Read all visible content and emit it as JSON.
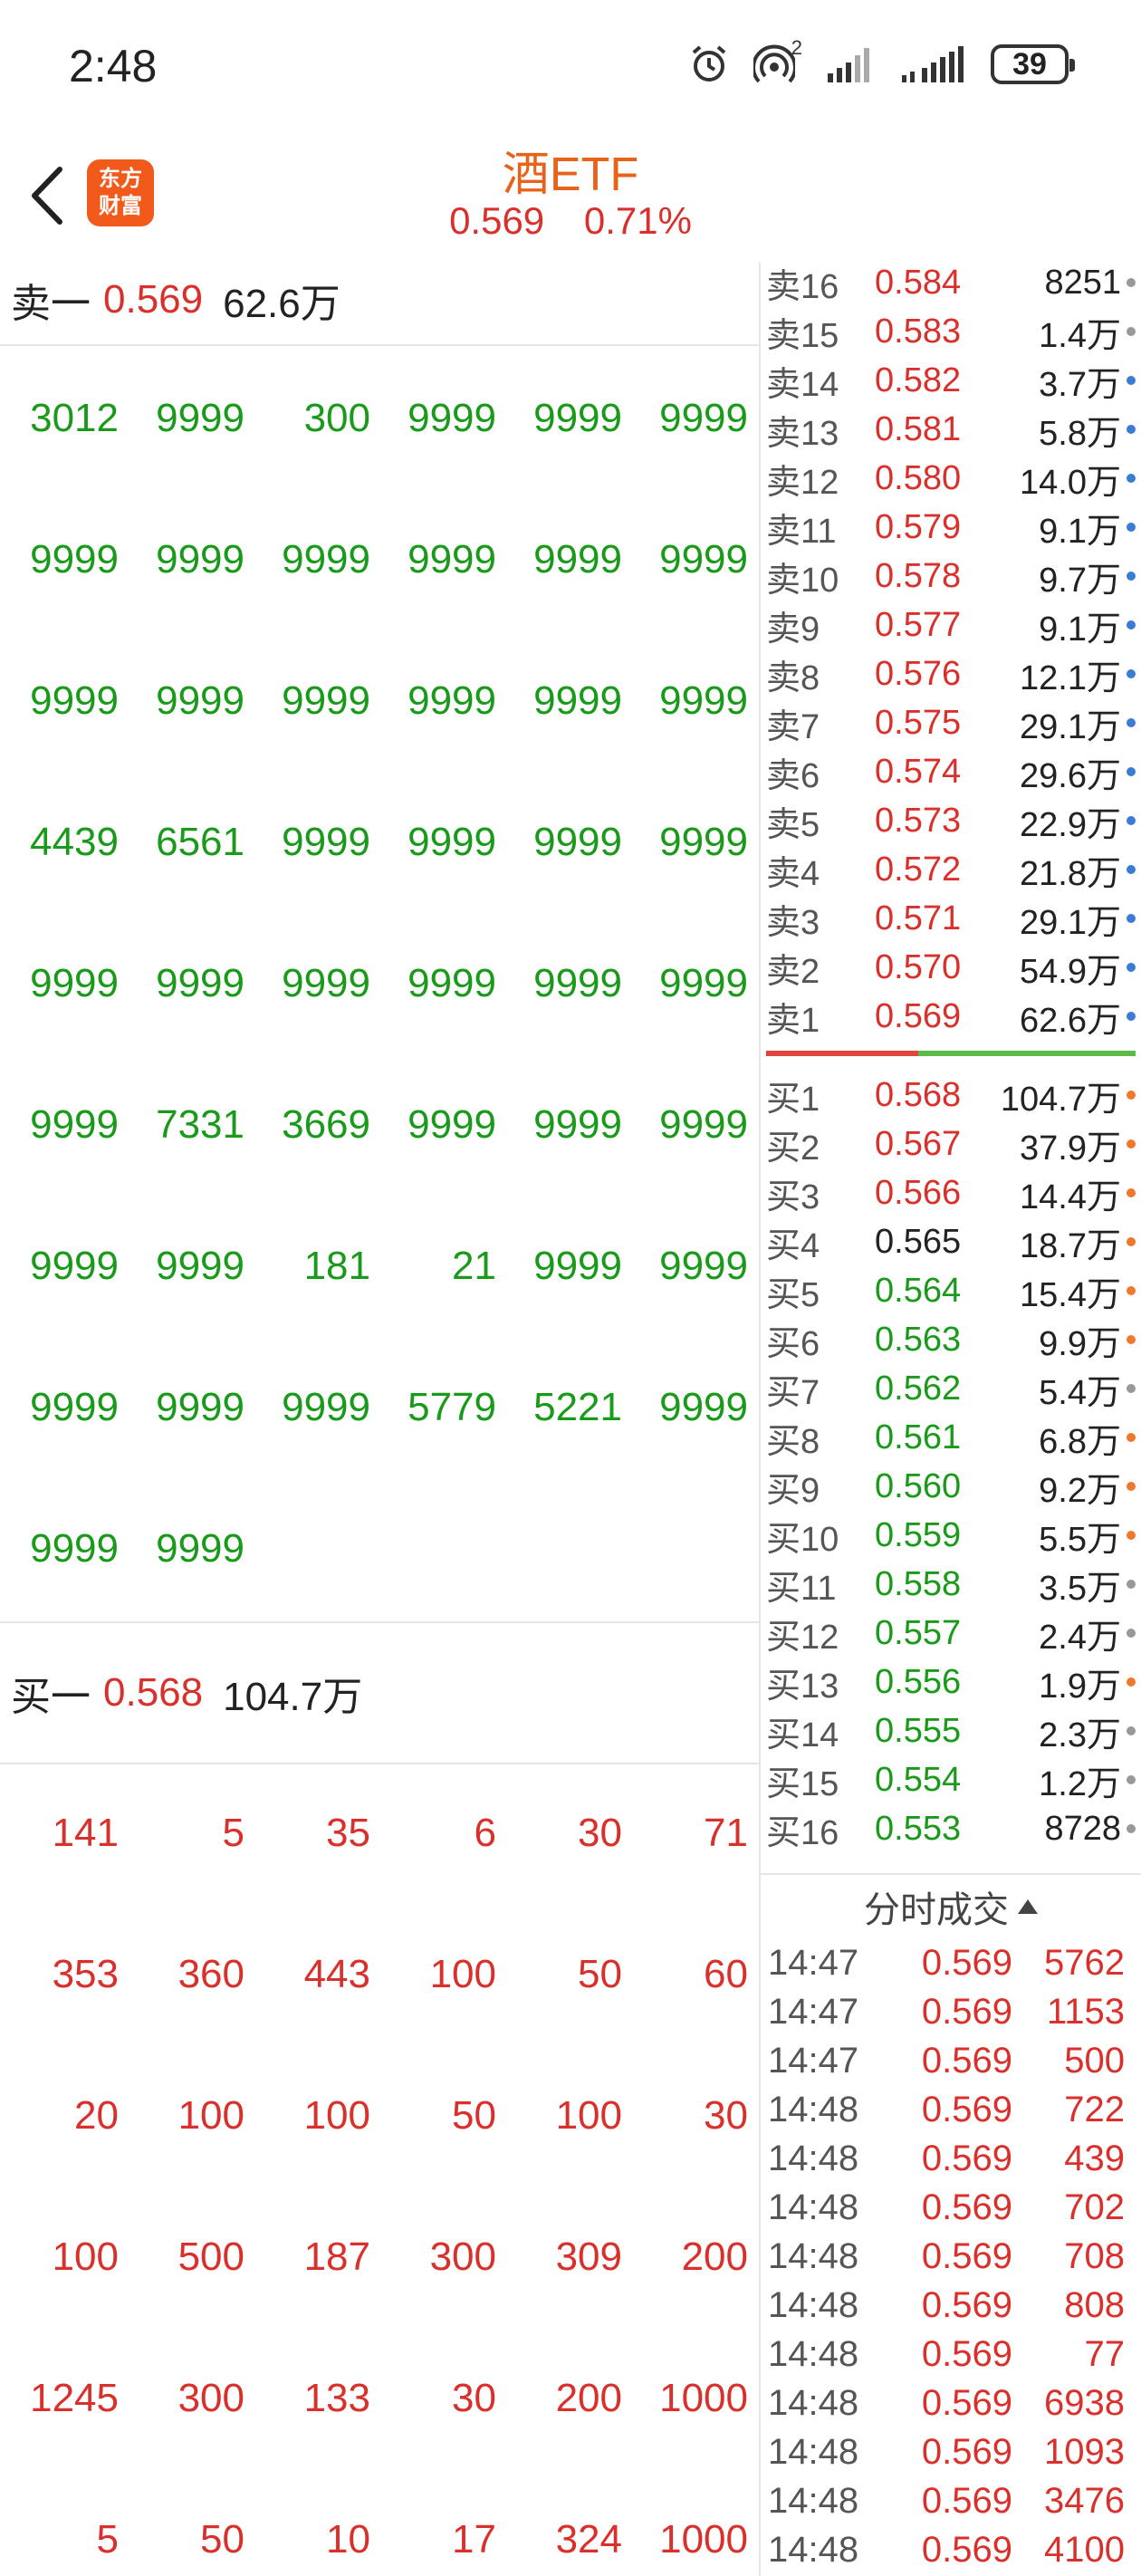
{
  "status": {
    "time": "2:48",
    "battery": "39",
    "hotspot_sup": "2"
  },
  "header": {
    "title": "酒ETF",
    "price": "0.569",
    "change": "0.71%",
    "logo_line1": "东方",
    "logo_line2": "财富"
  },
  "sell_level": {
    "label": "卖一",
    "price": "0.569",
    "volume": "62.6万"
  },
  "buy_level": {
    "label": "买一",
    "price": "0.568",
    "volume": "104.7万"
  },
  "sell_queue": [
    [
      "3012",
      "9999",
      "300",
      "9999",
      "9999",
      "9999"
    ],
    [
      "9999",
      "9999",
      "9999",
      "9999",
      "9999",
      "9999"
    ],
    [
      "9999",
      "9999",
      "9999",
      "9999",
      "9999",
      "9999"
    ],
    [
      "4439",
      "6561",
      "9999",
      "9999",
      "9999",
      "9999"
    ],
    [
      "9999",
      "9999",
      "9999",
      "9999",
      "9999",
      "9999"
    ],
    [
      "9999",
      "7331",
      "3669",
      "9999",
      "9999",
      "9999"
    ],
    [
      "9999",
      "9999",
      "181",
      "21",
      "9999",
      "9999"
    ],
    [
      "9999",
      "9999",
      "9999",
      "5779",
      "5221",
      "9999"
    ],
    [
      "9999",
      "9999",
      "",
      "",
      "",
      ""
    ]
  ],
  "buy_queue": [
    [
      "141",
      "5",
      "35",
      "6",
      "30",
      "71"
    ],
    [
      "353",
      "360",
      "443",
      "100",
      "50",
      "60"
    ],
    [
      "20",
      "100",
      "100",
      "50",
      "100",
      "30"
    ],
    [
      "100",
      "500",
      "187",
      "300",
      "309",
      "200"
    ],
    [
      "1245",
      "300",
      "133",
      "30",
      "200",
      "1000"
    ],
    [
      "5",
      "50",
      "10",
      "17",
      "324",
      "1000"
    ]
  ],
  "asks": [
    {
      "label": "卖16",
      "price": "0.584",
      "volume": "8251",
      "dot": "gray"
    },
    {
      "label": "卖15",
      "price": "0.583",
      "volume": "1.4万",
      "dot": "gray"
    },
    {
      "label": "卖14",
      "price": "0.582",
      "volume": "3.7万",
      "dot": "blue"
    },
    {
      "label": "卖13",
      "price": "0.581",
      "volume": "5.8万",
      "dot": "blue"
    },
    {
      "label": "卖12",
      "price": "0.580",
      "volume": "14.0万",
      "dot": "blue"
    },
    {
      "label": "卖11",
      "price": "0.579",
      "volume": "9.1万",
      "dot": "blue"
    },
    {
      "label": "卖10",
      "price": "0.578",
      "volume": "9.7万",
      "dot": "blue"
    },
    {
      "label": "卖9",
      "price": "0.577",
      "volume": "9.1万",
      "dot": "blue"
    },
    {
      "label": "卖8",
      "price": "0.576",
      "volume": "12.1万",
      "dot": "blue"
    },
    {
      "label": "卖7",
      "price": "0.575",
      "volume": "29.1万",
      "dot": "blue"
    },
    {
      "label": "卖6",
      "price": "0.574",
      "volume": "29.6万",
      "dot": "blue"
    },
    {
      "label": "卖5",
      "price": "0.573",
      "volume": "22.9万",
      "dot": "blue"
    },
    {
      "label": "卖4",
      "price": "0.572",
      "volume": "21.8万",
      "dot": "blue"
    },
    {
      "label": "卖3",
      "price": "0.571",
      "volume": "29.1万",
      "dot": "blue"
    },
    {
      "label": "卖2",
      "price": "0.570",
      "volume": "54.9万",
      "dot": "blue"
    },
    {
      "label": "卖1",
      "price": "0.569",
      "volume": "62.6万",
      "dot": "blue"
    }
  ],
  "bids": [
    {
      "label": "买1",
      "price": "0.568",
      "volume": "104.7万",
      "dot": "orange",
      "color": "red"
    },
    {
      "label": "买2",
      "price": "0.567",
      "volume": "37.9万",
      "dot": "orange",
      "color": "red"
    },
    {
      "label": "买3",
      "price": "0.566",
      "volume": "14.4万",
      "dot": "orange",
      "color": "red"
    },
    {
      "label": "买4",
      "price": "0.565",
      "volume": "18.7万",
      "dot": "orange",
      "color": "dark"
    },
    {
      "label": "买5",
      "price": "0.564",
      "volume": "15.4万",
      "dot": "orange",
      "color": "green"
    },
    {
      "label": "买6",
      "price": "0.563",
      "volume": "9.9万",
      "dot": "orange",
      "color": "green"
    },
    {
      "label": "买7",
      "price": "0.562",
      "volume": "5.4万",
      "dot": "gray",
      "color": "green"
    },
    {
      "label": "买8",
      "price": "0.561",
      "volume": "6.8万",
      "dot": "orange",
      "color": "green"
    },
    {
      "label": "买9",
      "price": "0.560",
      "volume": "9.2万",
      "dot": "orange",
      "color": "green"
    },
    {
      "label": "买10",
      "price": "0.559",
      "volume": "5.5万",
      "dot": "orange",
      "color": "green"
    },
    {
      "label": "买11",
      "price": "0.558",
      "volume": "3.5万",
      "dot": "gray",
      "color": "green"
    },
    {
      "label": "买12",
      "price": "0.557",
      "volume": "2.4万",
      "dot": "gray",
      "color": "green"
    },
    {
      "label": "买13",
      "price": "0.556",
      "volume": "1.9万",
      "dot": "orange",
      "color": "green"
    },
    {
      "label": "买14",
      "price": "0.555",
      "volume": "2.3万",
      "dot": "gray",
      "color": "green"
    },
    {
      "label": "买15",
      "price": "0.554",
      "volume": "1.2万",
      "dot": "gray",
      "color": "green"
    },
    {
      "label": "买16",
      "price": "0.553",
      "volume": "8728",
      "dot": "gray",
      "color": "green"
    }
  ],
  "time_sales": {
    "title": "分时成交",
    "rows": [
      {
        "time": "14:47",
        "price": "0.569",
        "volume": "5762"
      },
      {
        "time": "14:47",
        "price": "0.569",
        "volume": "1153"
      },
      {
        "time": "14:47",
        "price": "0.569",
        "volume": "500"
      },
      {
        "time": "14:48",
        "price": "0.569",
        "volume": "722"
      },
      {
        "time": "14:48",
        "price": "0.569",
        "volume": "439"
      },
      {
        "time": "14:48",
        "price": "0.569",
        "volume": "702"
      },
      {
        "time": "14:48",
        "price": "0.569",
        "volume": "708"
      },
      {
        "time": "14:48",
        "price": "0.569",
        "volume": "808"
      },
      {
        "time": "14:48",
        "price": "0.569",
        "volume": "77"
      },
      {
        "time": "14:48",
        "price": "0.569",
        "volume": "6938"
      },
      {
        "time": "14:48",
        "price": "0.569",
        "volume": "1093"
      },
      {
        "time": "14:48",
        "price": "0.569",
        "volume": "3476"
      },
      {
        "time": "14:48",
        "price": "0.569",
        "volume": "4100"
      }
    ]
  },
  "colors": {
    "up": "#d9302c",
    "down": "#1a9a1a",
    "brand": "#f25a1c",
    "title": "#e8631a"
  }
}
